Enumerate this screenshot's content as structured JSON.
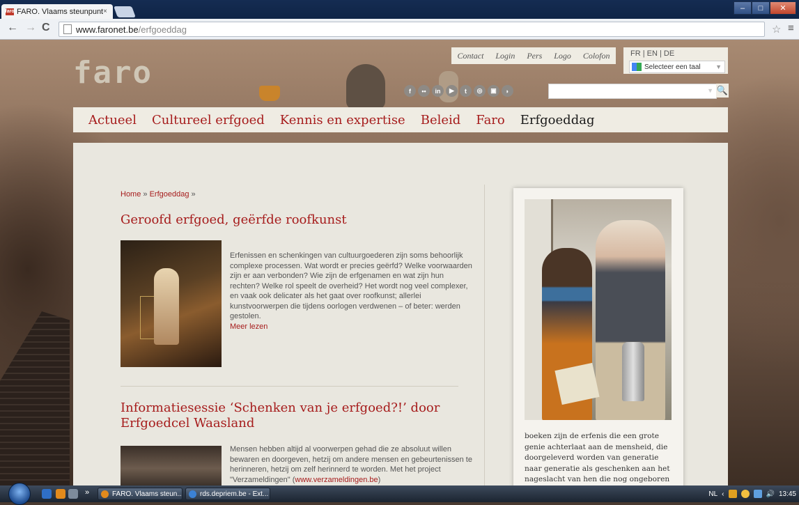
{
  "browser": {
    "tab_title": "FARO. Vlaams steunpunt",
    "tab_close": "×",
    "favicon_text": "faro",
    "url_host": "www.faronet.be",
    "url_path": "/erfgoeddag",
    "win_min": "–",
    "win_max": "□",
    "win_close": "✕"
  },
  "site": {
    "logo": "faro",
    "top_links": [
      "Contact",
      "Login",
      "Pers",
      "Logo",
      "Colofon"
    ],
    "languages": "FR | EN | DE",
    "translate_label": "Selecteer een taal",
    "translate_arrow": "▼",
    "social_icons": [
      "facebook-icon",
      "flickr-icon",
      "linkedin-icon",
      "youtube-icon",
      "twitter-icon",
      "issuu-icon",
      "youtube-tv-icon",
      "rss-icon"
    ],
    "social_glyphs": [
      "f",
      "••",
      "in",
      "▶",
      "t",
      "◎",
      "▣",
      "◗"
    ],
    "search_placeholder": "",
    "search_glyph": "🔍",
    "nav": [
      "Actueel",
      "Cultureel erfgoed",
      "Kennis en expertise",
      "Beleid",
      "Faro",
      "Erfgoeddag"
    ],
    "nav_active": "Erfgoeddag"
  },
  "breadcrumb": {
    "home": "Home",
    "sep": "»",
    "current": "Erfgoeddag"
  },
  "articles": [
    {
      "title": "Geroofd erfgoed, geërfde roofkunst",
      "excerpt": "Erfenissen en schenkingen van cultuurgoederen zijn soms behoorlijk complexe processen. Wat wordt er precies geërfd? Welke voorwaarden zijn er aan verbonden? Wie zijn de erfgenamen en wat zijn hun rechten? Welke rol speelt de overheid? Het wordt nog veel complexer, en vaak ook delicater als het gaat over roofkunst; allerlei kunstvoorwerpen die tijdens oorlogen verdwenen – of beter: werden gestolen.",
      "read_more": "Meer lezen"
    },
    {
      "title_line1": "Informatiesessie ‘Schenken van je erfgoed?!’ door",
      "title_line2": "Erfgoedcel Waasland",
      "excerpt": "Mensen hebben altijd al voorwerpen gehad die ze absoluut willen bewaren en doorgeven, hetzij om andere mensen en gebeurtenissen te herinneren, hetzij om zelf herinnerd te worden. Met het project \"Verzameldingen\" (",
      "link": "www.verzameldingen.be",
      "after_link": ")"
    }
  ],
  "sidebar": {
    "quote": "boeken zijn de erfenis die een grote genie achterlaat aan de mensheid, die doorgeleverd worden van generatie naar generatie als geschenken aan het nageslacht van hen die nog ongeboren zijn (Joseph addison)"
  },
  "taskbar": {
    "buttons": [
      "FARO. Vlaams steun...",
      "rds.depriem.be - Ext..."
    ],
    "more": "»",
    "lang": "NL",
    "clock": "13:45",
    "tray_arrow": "‹"
  }
}
